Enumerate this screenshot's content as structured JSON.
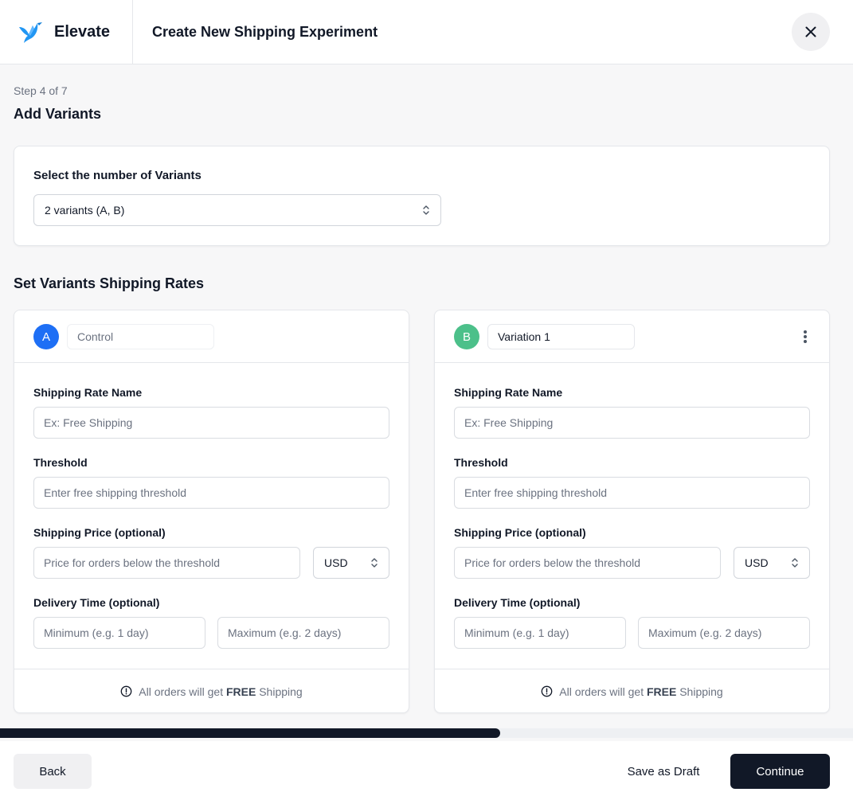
{
  "header": {
    "brand_name": "Elevate",
    "title": "Create New Shipping Experiment",
    "close_icon": "close-icon"
  },
  "step": {
    "label": "Step 4 of 7",
    "title": "Add Variants"
  },
  "variant_count": {
    "label": "Select the number of Variants",
    "selected": "2 variants (A, B)"
  },
  "rates_title": "Set Variants Shipping Rates",
  "variants": [
    {
      "letter": "A",
      "color": "#1e6ff5",
      "name_value": "Control",
      "name_editable": false,
      "has_menu": false,
      "shipping_rate_name": {
        "label": "Shipping Rate Name",
        "placeholder": "Ex: Free Shipping",
        "value": ""
      },
      "threshold": {
        "label": "Threshold",
        "placeholder": "Enter free shipping threshold",
        "value": ""
      },
      "shipping_price": {
        "label": "Shipping Price (optional)",
        "placeholder": "Price for orders below the threshold",
        "value": "",
        "currency": "USD"
      },
      "delivery_time": {
        "label": "Delivery Time (optional)",
        "min_placeholder": "Minimum (e.g. 1 day)",
        "max_placeholder": "Maximum (e.g. 2 days)"
      },
      "footer": {
        "prefix": "All orders will get",
        "emphasis": "FREE",
        "suffix": "Shipping"
      }
    },
    {
      "letter": "B",
      "color": "#4cc08a",
      "name_value": "Variation 1",
      "name_editable": true,
      "has_menu": true,
      "shipping_rate_name": {
        "label": "Shipping Rate Name",
        "placeholder": "Ex: Free Shipping",
        "value": ""
      },
      "threshold": {
        "label": "Threshold",
        "placeholder": "Enter free shipping threshold",
        "value": ""
      },
      "shipping_price": {
        "label": "Shipping Price (optional)",
        "placeholder": "Price for orders below the threshold",
        "value": "",
        "currency": "USD"
      },
      "delivery_time": {
        "label": "Delivery Time (optional)",
        "min_placeholder": "Minimum (e.g. 1 day)",
        "max_placeholder": "Maximum (e.g. 2 days)"
      },
      "footer": {
        "prefix": "All orders will get",
        "emphasis": "FREE",
        "suffix": "Shipping"
      }
    }
  ],
  "progress": {
    "fraction": 0.586
  },
  "footer": {
    "back_label": "Back",
    "draft_label": "Save as Draft",
    "continue_label": "Continue"
  }
}
